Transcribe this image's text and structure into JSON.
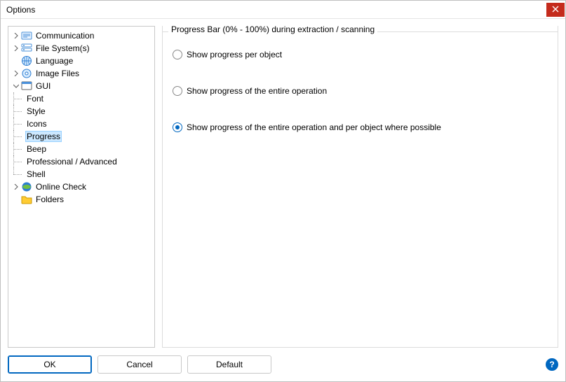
{
  "window": {
    "title": "Options"
  },
  "tree": {
    "communication": "Communication",
    "filesystems": "File System(s)",
    "language": "Language",
    "imagefiles": "Image Files",
    "gui": "GUI",
    "gui_children": {
      "font": "Font",
      "style": "Style",
      "icons": "Icons",
      "progress": "Progress",
      "beep": "Beep",
      "prof": "Professional / Advanced",
      "shell": "Shell"
    },
    "onlinecheck": "Online Check",
    "folders": "Folders"
  },
  "group": {
    "title": "Progress Bar (0% - 100%) during extraction / scanning",
    "radio1": "Show progress per object",
    "radio2": "Show progress of the entire operation",
    "radio3": "Show progress of the entire operation and per object where possible",
    "selected": 3
  },
  "footer": {
    "ok": "OK",
    "cancel": "Cancel",
    "default_btn": "Default",
    "help": "?"
  }
}
